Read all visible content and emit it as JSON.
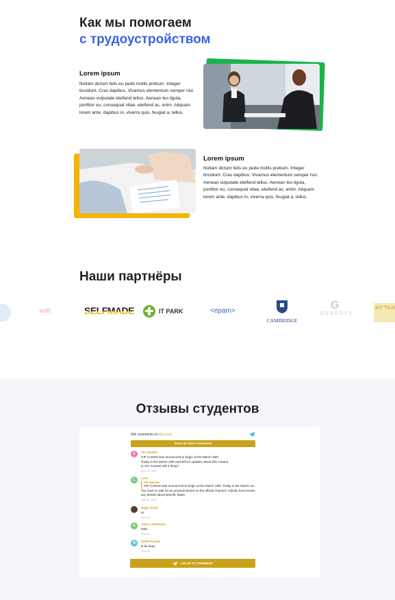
{
  "help": {
    "title_line1": "Как мы помогаем",
    "title_line2": "с трудоустройством",
    "cards": [
      {
        "title": "Lorem ipsum",
        "text": "Nullam dictum felis eu pede mollis pretium. Integer tincidunt. Cras dapibus. Vivamus elementum semper nisi. Aenean vulputate eleifend tellus. Aenean leo ligula, porttitor eu, consequat vitae, eleifend ac, enim. Aliquam lorem ante, dapibus in, viverra quis, feugiat a, tellus."
      },
      {
        "title": "Lorem ipsum",
        "text": "Nullam dictum felis eu pede mollis pretium. Integer tincidunt. Cras dapibus. Vivamus elementum semper nisi. Aenean vulputate eleifend tellus. Aenean leo ligula, porttitor eu, consequat vitae, eleifend ac, enim. Aliquam lorem ante, dapibus in, viverra quis, feugiat a, tellus."
      }
    ]
  },
  "partners": {
    "title": "Наши партнёры",
    "logos": [
      "soft",
      "SELFMADE",
      "IT PARK",
      "<epam>",
      "CAMBRIDGE",
      "GENESYS",
      "MY TAXI"
    ]
  },
  "reviews": {
    "title": "Отзывы студентов",
    "widget": {
      "count_label": "666 comments on",
      "post_link": "this post",
      "show_more": "Show 50 more comments",
      "login": "LOG IN TO COMMENT",
      "comments": [
        {
          "initial": "Z",
          "name": "Zer Nacher",
          "lines": [
            "GIF Contest was announced to begin at the March 15th.",
            "Today is the March 16th and still no updates about this contest.",
            "Is GIF Contest still a thing?"
          ],
          "date": "Mar 16, 2021"
        },
        {
          "initial": "L",
          "name": "Lore",
          "quote_name": "Zer Nacher",
          "quote": "GIF Contest was announced to begin at the March 15th. Today is the March 16...",
          "lines": [
            "You have to wait for an announcement on the official channel; nobody here knows",
            "any details about specific dates."
          ],
          "date": "Mar 16, 2021"
        },
        {
          "initial": "",
          "name": "Nagy Yosef",
          "lines": [
            "Hi"
          ],
          "date": "Feb 19"
        },
        {
          "initial": "A",
          "name": "Anon comments",
          "lines": [
            "hello"
          ],
          "date": "Feb 24"
        },
        {
          "initial": "S",
          "name": "Smith Karma",
          "lines": [
            "В бе бнас"
          ],
          "date": "Feb 21"
        }
      ]
    }
  },
  "colors": {
    "accent_blue": "#3b63e3",
    "green": "#19b34a",
    "yellow": "#f5b400",
    "gold": "#c9a21a"
  }
}
